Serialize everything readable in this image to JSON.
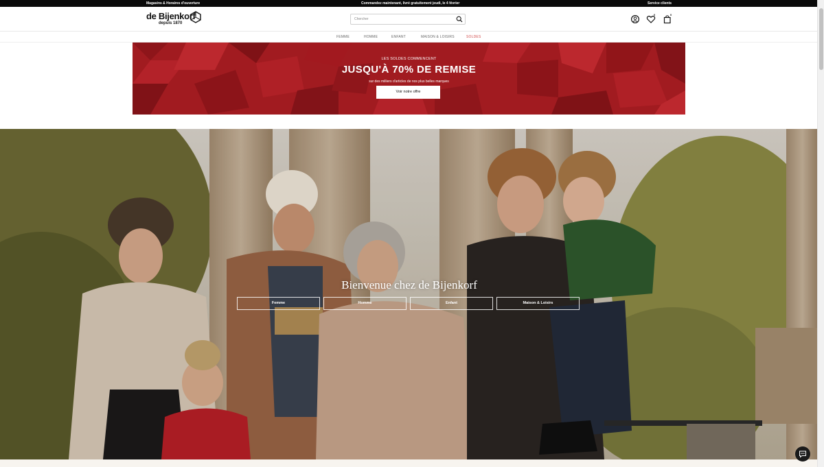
{
  "topbar": {
    "left": "Magasins & Horaires d'ouverture",
    "center": "Commandez maintenant, livré gratuitement jeudi, le 4 février",
    "right": "Service clients"
  },
  "header": {
    "logo_name": "de Bijenkorf",
    "logo_sub": "depuis 1870",
    "search_placeholder": "Chercher",
    "wishlist_count": "0",
    "bag_count": "0"
  },
  "categories": [
    "FEMME",
    "HOMME",
    "ENFANT",
    "MAISON & LOISIRS",
    "SOLDES"
  ],
  "banner": {
    "kicker": "LES SOLDES COMMENCENT",
    "title": "JUSQU'À 70% DE REMISE",
    "subtitle": "sur des milliers d'articles de nos plus belles marques",
    "button": "Voir notre offre",
    "color": "#a11b20"
  },
  "hero": {
    "title": "Bienvenue chez de Bijenkorf",
    "buttons": [
      "Femme",
      "Homme",
      "Enfant",
      "Maison & Loisirs"
    ]
  },
  "colors": {
    "sale_red": "#d14a4a",
    "banner_red": "#a11b20"
  },
  "icons": [
    "account-icon",
    "heart-icon",
    "bag-icon",
    "search-icon",
    "chat-icon"
  ]
}
